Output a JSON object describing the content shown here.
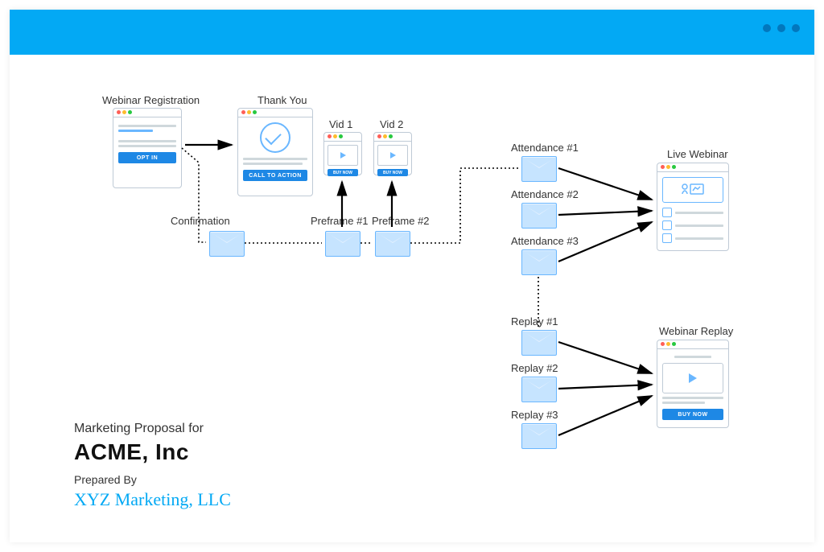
{
  "header": {
    "dots": 3
  },
  "labels": {
    "registration": "Webinar Registration",
    "thankyou": "Thank You",
    "vid1": "Vid 1",
    "vid2": "Vid 2",
    "confirmation": "Confirmation",
    "preframe1": "Preframe #1",
    "preframe2": "Preframe #2",
    "attendance1": "Attendance #1",
    "attendance2": "Attendance #2",
    "attendance3": "Attendance #3",
    "replay1": "Replay #1",
    "replay2": "Replay #2",
    "replay3": "Replay #3",
    "live": "Live Webinar",
    "replay": "Webinar Replay"
  },
  "buttons": {
    "optin": "OPT IN",
    "cta": "CALL TO ACTION",
    "buynow": "BUY NOW"
  },
  "titleblock": {
    "prefor": "Marketing Proposal for",
    "client": "ACME, Inc",
    "prepby": "Prepared By",
    "agency": "XYZ Marketing, LLC"
  },
  "diagram": {
    "nodes": [
      {
        "id": "registration",
        "type": "page-optin",
        "label": "Webinar Registration"
      },
      {
        "id": "thankyou",
        "type": "page-cta",
        "label": "Thank You"
      },
      {
        "id": "vid1",
        "type": "page-video",
        "label": "Vid 1"
      },
      {
        "id": "vid2",
        "type": "page-video",
        "label": "Vid 2"
      },
      {
        "id": "live",
        "type": "page-live",
        "label": "Live Webinar"
      },
      {
        "id": "replay",
        "type": "page-replay",
        "label": "Webinar Replay"
      },
      {
        "id": "m_confirm",
        "type": "email",
        "label": "Confirmation"
      },
      {
        "id": "m_pre1",
        "type": "email",
        "label": "Preframe #1"
      },
      {
        "id": "m_pre2",
        "type": "email",
        "label": "Preframe #2"
      },
      {
        "id": "m_att1",
        "type": "email",
        "label": "Attendance #1"
      },
      {
        "id": "m_att2",
        "type": "email",
        "label": "Attendance #2"
      },
      {
        "id": "m_att3",
        "type": "email",
        "label": "Attendance #3"
      },
      {
        "id": "m_rep1",
        "type": "email",
        "label": "Replay #1"
      },
      {
        "id": "m_rep2",
        "type": "email",
        "label": "Replay #2"
      },
      {
        "id": "m_rep3",
        "type": "email",
        "label": "Replay #3"
      }
    ],
    "edges": [
      {
        "from": "registration",
        "to": "thankyou",
        "style": "solid-arrow"
      },
      {
        "from": "registration",
        "to": "m_confirm",
        "style": "dotted"
      },
      {
        "from": "m_confirm",
        "to": "m_pre1",
        "style": "dotted"
      },
      {
        "from": "m_pre1",
        "to": "m_pre2",
        "style": "dotted"
      },
      {
        "from": "m_pre1",
        "to": "vid1",
        "style": "solid-arrow"
      },
      {
        "from": "m_pre2",
        "to": "vid2",
        "style": "solid-arrow"
      },
      {
        "from": "m_pre2",
        "to": "m_att1",
        "style": "dotted"
      },
      {
        "from": "m_att1",
        "to": "live",
        "style": "solid-arrow"
      },
      {
        "from": "m_att2",
        "to": "live",
        "style": "solid-arrow"
      },
      {
        "from": "m_att3",
        "to": "live",
        "style": "solid-arrow"
      },
      {
        "from": "m_att3",
        "to": "m_rep1",
        "style": "dotted"
      },
      {
        "from": "m_rep1",
        "to": "replay",
        "style": "solid-arrow"
      },
      {
        "from": "m_rep2",
        "to": "replay",
        "style": "solid-arrow"
      },
      {
        "from": "m_rep3",
        "to": "replay",
        "style": "solid-arrow"
      }
    ]
  }
}
